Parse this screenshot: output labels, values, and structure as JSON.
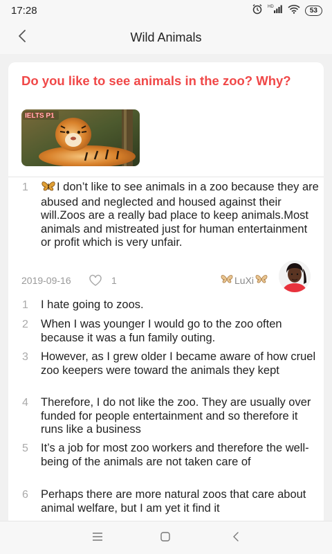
{
  "status_bar": {
    "time": "17:28",
    "battery": "53",
    "network_label": "HD"
  },
  "nav": {
    "title": "Wild Animals"
  },
  "question": {
    "title": "Do you like to see animals in the zoo? Why?",
    "image_badge": "IELTS P1"
  },
  "answers": [
    {
      "num": "1",
      "text": "I don’t like to see animals in a zoo because they are abused and neglected and housed against their will.Zoos are a really bad place to keep animals.Most animals and mistreated just for human entertainment or profit which is very unfair.",
      "date": "2019-09-16",
      "likes": "1",
      "author": "LuXi"
    }
  ],
  "lines": [
    {
      "num": "1",
      "text": "I hate going to zoos."
    },
    {
      "num": "2",
      "text": "When I was younger I would go to the zoo often because it was a fun family outing."
    },
    {
      "num": "3",
      "text": "However, as I grew older I became aware of how cruel zoo keepers were toward the animals they kept"
    },
    {
      "num": "4",
      "text": "Therefore, I do not like the zoo. They are usually over funded for people entertainment and so therefore it runs like a business"
    },
    {
      "num": "5",
      "text": "It’s a job for most zoo workers and therefore the well-being of the animals are not taken care of"
    },
    {
      "num": "6",
      "text": "Perhaps there are more natural zoos that care about animal welfare, but I am yet it find it"
    }
  ],
  "icons": {
    "back": "chevron-left-icon",
    "heart": "heart-outline-icon",
    "butterfly": "butterfly-icon",
    "menu": "menu-icon",
    "home": "square-home-icon",
    "system_back": "system-back-icon"
  },
  "colors": {
    "accent": "#f04848",
    "background": "#f1f1f1",
    "card": "#ffffff"
  }
}
